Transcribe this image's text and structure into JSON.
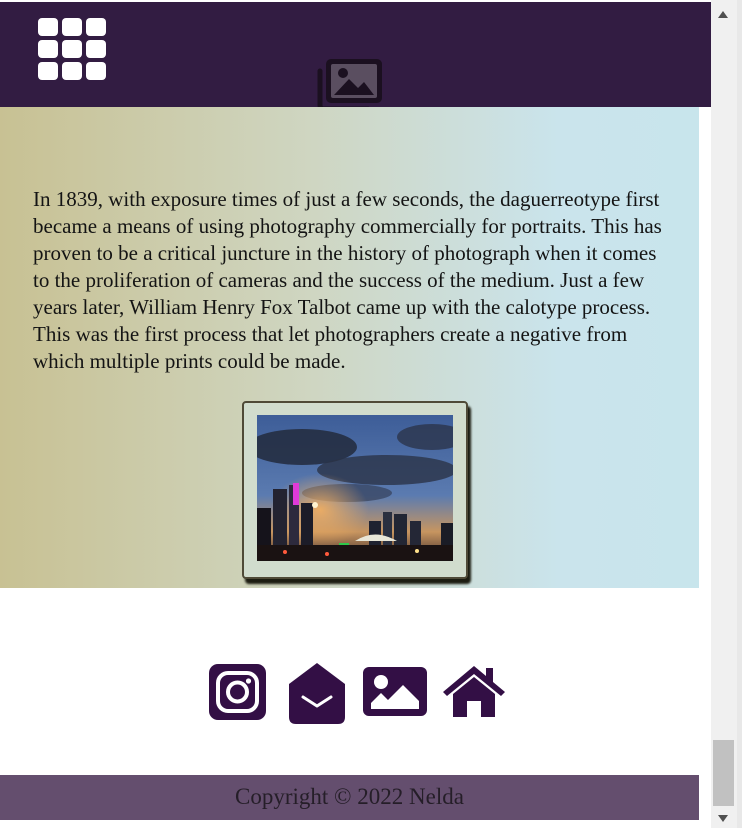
{
  "header": {
    "menu_icon": "grid-menu-icon",
    "gallery_icon": "photo-gallery-icon",
    "color": "#321c42"
  },
  "main": {
    "article_text": "In 1839, with exposure times of just a few seconds, the daguerreotype first became a means of using photography commercially for portraits. This has proven to be a critical juncture in the history of photograph when it comes to the proliferation of cameras and the success of the medium. Just a few years later, William Henry Fox Talbot came up with the calotype process. This was the first process that let photographers create a negative from which multiple prints could be made.",
    "photo": "city-skyline-dusk-image"
  },
  "social": {
    "icons": [
      "instagram-icon",
      "envelope-open-icon",
      "image-icon",
      "home-icon"
    ],
    "color": "#330f45"
  },
  "footer": {
    "copyright": "Copyright © 2022 Nelda",
    "color": "#644e6e"
  }
}
